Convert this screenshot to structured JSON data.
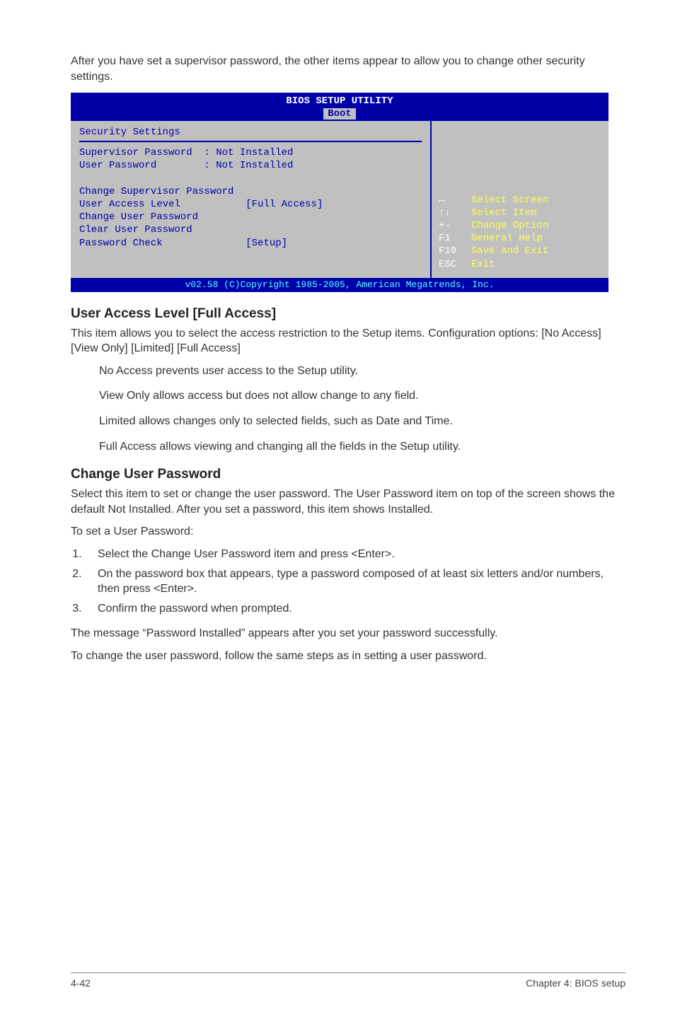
{
  "intro": "After you have set a supervisor password, the other items appear to allow you to change other security settings.",
  "bios": {
    "title": "BIOS SETUP UTILITY",
    "tab": "Boot",
    "section_title": "Security Settings",
    "lines": {
      "supervisor": "Supervisor Password  : Not Installed",
      "user": "User Password        : Not Installed",
      "blank1": " ",
      "change_sup": "Change Supervisor Password",
      "ual": "User Access Level           [Full Access]",
      "cup": "Change User Password",
      "clr": "Clear User Password",
      "pwc": "Password Check              [Setup]"
    },
    "help": [
      {
        "key": "↔",
        "act": "Select Screen"
      },
      {
        "key": "↑↓",
        "act": "Select Item"
      },
      {
        "key": "+-",
        "act": "Change Option"
      },
      {
        "key": "F1",
        "act": "General Help"
      },
      {
        "key": "F10",
        "act": "Save and Exit"
      },
      {
        "key": "ESC",
        "act": "Exit"
      }
    ],
    "footer": "v02.58 (C)Copyright 1985-2005, American Megatrends, Inc."
  },
  "ual_heading": "User Access Level [Full Access]",
  "ual_p1": "This item allows you to select the access restriction to the Setup items. Configuration options: [No Access] [View Only] [Limited] [Full Access]",
  "ual_opts": {
    "no_access": "No Access prevents user access to the Setup utility.",
    "view_only": "View Only allows access but does not allow change to any field.",
    "limited": "Limited allows changes only to selected fields, such as Date and Time.",
    "full": "Full Access allows viewing and changing all the fields in the Setup utility."
  },
  "cup_heading": "Change User Password",
  "cup_p1": "Select this item to set or change the user password. The User Password item on top of the screen shows the default Not Installed. After you set a password, this item shows Installed.",
  "cup_p2": "To set a User Password:",
  "steps": {
    "s1": "Select the Change User Password item and press <Enter>.",
    "s2": "On the password box that appears, type a password composed of at least six letters and/or numbers, then press <Enter>.",
    "s3": "Confirm the password when prompted."
  },
  "post1": "The message “Password Installed” appears after you set your password successfully.",
  "post2": "To change the user password, follow the same steps as in setting a user password.",
  "footer_left": "4-42",
  "footer_right": "Chapter 4: BIOS setup"
}
